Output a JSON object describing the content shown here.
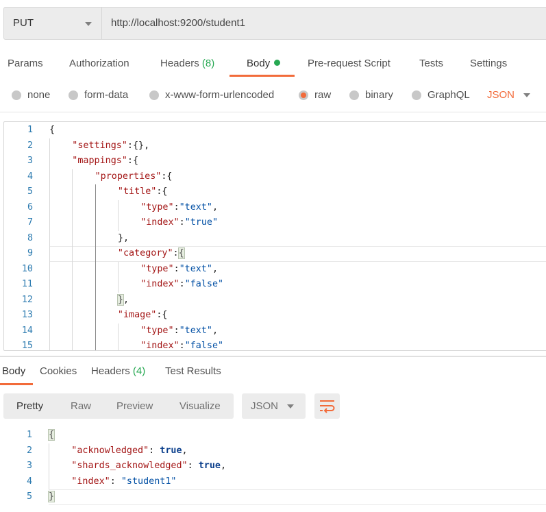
{
  "request": {
    "method": "PUT",
    "url": "http://localhost:9200/student1"
  },
  "request_tabs": [
    {
      "label": "Params"
    },
    {
      "label": "Authorization"
    },
    {
      "label": "Headers",
      "count": "(8)"
    },
    {
      "label": "Body",
      "active": true,
      "indicator": "green-dot"
    },
    {
      "label": "Pre-request Script"
    },
    {
      "label": "Tests"
    },
    {
      "label": "Settings"
    }
  ],
  "body_types": [
    {
      "label": "none",
      "selected": false
    },
    {
      "label": "form-data",
      "selected": false
    },
    {
      "label": "x-www-form-urlencoded",
      "selected": false
    },
    {
      "label": "raw",
      "selected": true
    },
    {
      "label": "binary",
      "selected": false
    },
    {
      "label": "GraphQL",
      "selected": false
    }
  ],
  "raw_format": "JSON",
  "colors": {
    "accent": "#f26b3a",
    "green": "#26a852",
    "key": "#a31515",
    "string": "#0451a5"
  },
  "request_body": [
    {
      "n": "1",
      "indent": 0,
      "tokens": [
        [
          "punc",
          "{"
        ]
      ]
    },
    {
      "n": "2",
      "indent": 1,
      "tokens": [
        [
          "key",
          "\"settings\""
        ],
        [
          "punc",
          ":{},"
        ]
      ]
    },
    {
      "n": "3",
      "indent": 1,
      "tokens": [
        [
          "key",
          "\"mappings\""
        ],
        [
          "punc",
          ":{"
        ]
      ]
    },
    {
      "n": "4",
      "indent": 2,
      "tokens": [
        [
          "key",
          "\"properties\""
        ],
        [
          "punc",
          ":{"
        ]
      ]
    },
    {
      "n": "5",
      "indent": 3,
      "tokens": [
        [
          "key",
          "\"title\""
        ],
        [
          "punc",
          ":{"
        ]
      ]
    },
    {
      "n": "6",
      "indent": 4,
      "tokens": [
        [
          "key",
          "\"type\""
        ],
        [
          "punc",
          ":"
        ],
        [
          "str",
          "\"text\""
        ],
        [
          "punc",
          ","
        ]
      ]
    },
    {
      "n": "7",
      "indent": 4,
      "tokens": [
        [
          "key",
          "\"index\""
        ],
        [
          "punc",
          ":"
        ],
        [
          "str",
          "\"true\""
        ]
      ]
    },
    {
      "n": "8",
      "indent": 3,
      "tokens": [
        [
          "punc",
          "},"
        ]
      ]
    },
    {
      "n": "9",
      "indent": 3,
      "active": true,
      "tokens": [
        [
          "key",
          "\"category\""
        ],
        [
          "punc",
          ":"
        ],
        [
          "brk",
          "{"
        ]
      ]
    },
    {
      "n": "10",
      "indent": 4,
      "tokens": [
        [
          "key",
          "\"type\""
        ],
        [
          "punc",
          ":"
        ],
        [
          "str",
          "\"text\""
        ],
        [
          "punc",
          ","
        ]
      ]
    },
    {
      "n": "11",
      "indent": 4,
      "tokens": [
        [
          "key",
          "\"index\""
        ],
        [
          "punc",
          ":"
        ],
        [
          "str",
          "\"false\""
        ]
      ]
    },
    {
      "n": "12",
      "indent": 3,
      "tokens": [
        [
          "brk",
          "}"
        ],
        [
          "punc",
          ","
        ]
      ]
    },
    {
      "n": "13",
      "indent": 3,
      "tokens": [
        [
          "key",
          "\"image\""
        ],
        [
          "punc",
          ":{"
        ]
      ]
    },
    {
      "n": "14",
      "indent": 4,
      "tokens": [
        [
          "key",
          "\"type\""
        ],
        [
          "punc",
          ":"
        ],
        [
          "str",
          "\"text\""
        ],
        [
          "punc",
          ","
        ]
      ]
    },
    {
      "n": "15",
      "indent": 4,
      "tokens": [
        [
          "key",
          "\"index\""
        ],
        [
          "punc",
          ":"
        ],
        [
          "str",
          "\"false\""
        ]
      ]
    }
  ],
  "response_tabs": [
    {
      "label": "Body",
      "active": true
    },
    {
      "label": "Cookies"
    },
    {
      "label": "Headers",
      "count": "(4)"
    },
    {
      "label": "Test Results"
    }
  ],
  "view_modes": [
    {
      "label": "Pretty",
      "active": true
    },
    {
      "label": "Raw"
    },
    {
      "label": "Preview"
    },
    {
      "label": "Visualize"
    }
  ],
  "response_format": "JSON",
  "response_body": [
    {
      "n": "1",
      "indent": 0,
      "tokens": [
        [
          "brk",
          "{"
        ]
      ]
    },
    {
      "n": "2",
      "indent": 1,
      "tokens": [
        [
          "key",
          "\"acknowledged\""
        ],
        [
          "punc",
          ": "
        ],
        [
          "bool",
          "true"
        ],
        [
          "punc",
          ","
        ]
      ]
    },
    {
      "n": "3",
      "indent": 1,
      "tokens": [
        [
          "key",
          "\"shards_acknowledged\""
        ],
        [
          "punc",
          ": "
        ],
        [
          "bool",
          "true"
        ],
        [
          "punc",
          ","
        ]
      ]
    },
    {
      "n": "4",
      "indent": 1,
      "tokens": [
        [
          "key",
          "\"index\""
        ],
        [
          "punc",
          ": "
        ],
        [
          "str",
          "\"student1\""
        ]
      ]
    },
    {
      "n": "5",
      "indent": 0,
      "active": true,
      "tokens": [
        [
          "brk",
          "}"
        ]
      ]
    }
  ]
}
